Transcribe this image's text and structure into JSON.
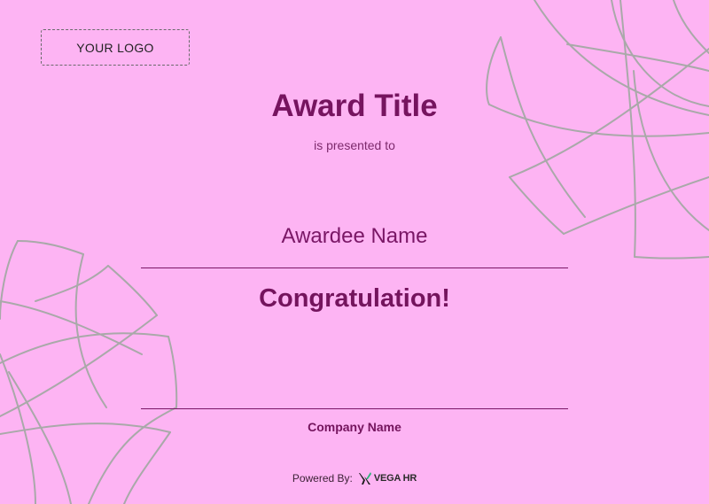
{
  "certificate": {
    "logo_placeholder": "YOUR LOGO",
    "award_title": "Award Title",
    "presented_to": "is presented to",
    "awardee_name": "Awardee Name",
    "congratulation": "Congratulation!",
    "company_name": "Company Name",
    "powered_by_label": "Powered By:",
    "brand_name": "VEGA HR"
  },
  "colors": {
    "background": "#fdb4f3",
    "title": "#76145f",
    "text": "#7a1766",
    "decoration_stroke": "#a8a8a8"
  },
  "icons": {
    "brand_logo": "vega-x-logo-icon",
    "decoration": "petal-swirl-decoration"
  }
}
